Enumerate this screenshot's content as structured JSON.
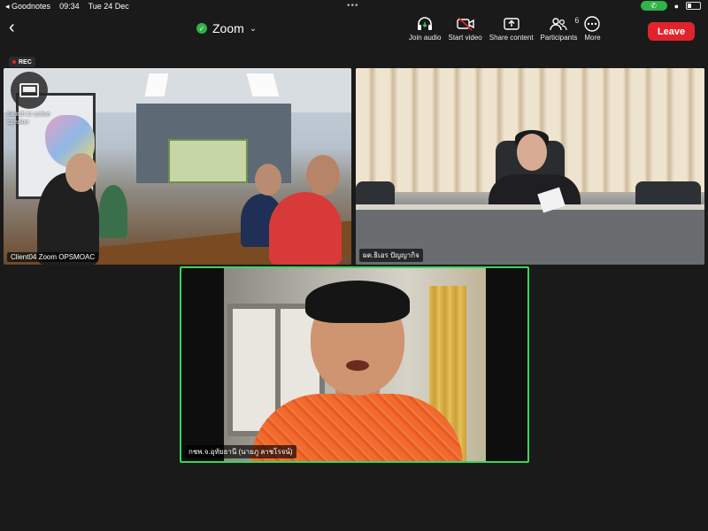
{
  "statusbar": {
    "back_app": "◂ Goodnotes",
    "time": "09:34",
    "date": "Tue 24 Dec",
    "dots": "•••"
  },
  "header": {
    "title": "Zoom",
    "leave_label": "Leave"
  },
  "toolbar": {
    "items": [
      {
        "label": "Join audio",
        "icon": "headphones-icon"
      },
      {
        "label": "Start video",
        "icon": "video-off-icon"
      },
      {
        "label": "Share content",
        "icon": "share-icon"
      },
      {
        "label": "Participants",
        "icon": "participants-icon",
        "badge": "6"
      },
      {
        "label": "More",
        "icon": "more-icon"
      }
    ]
  },
  "recording": {
    "label": "REC"
  },
  "tiles": [
    {
      "label": "Client04 Zoom OPSMOAC",
      "overlay": "Switch to active speaker"
    },
    {
      "label": "ผต.ธิเอร ปัญญากิจ"
    },
    {
      "label": "กชพ.จ.อุทัยธานี (นายภู ลาชโรจน์)"
    }
  ],
  "colors": {
    "leave": "#e0242d",
    "active_speaker_border": "#3bd45c",
    "secure_shield": "#2fb34a"
  }
}
